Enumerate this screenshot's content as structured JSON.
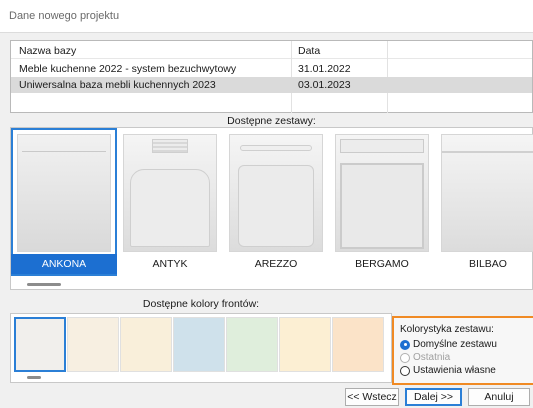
{
  "window": {
    "title": "Dane nowego projektu"
  },
  "db_table": {
    "columns": [
      "Nazwa bazy",
      "Data"
    ],
    "rows": [
      {
        "name": "Meble kuchenne 2022 - system bezuchwytowy",
        "date": "31.01.2022",
        "selected": false
      },
      {
        "name": "Uniwersalna baza mebli kuchennych 2023",
        "date": "03.01.2023",
        "selected": true
      }
    ]
  },
  "sets": {
    "label": "Dostępne zestawy:",
    "items": [
      {
        "name": "ANKONA",
        "selected": true
      },
      {
        "name": "ANTYK",
        "selected": false
      },
      {
        "name": "AREZZO",
        "selected": false
      },
      {
        "name": "BERGAMO",
        "selected": false
      },
      {
        "name": "BILBAO",
        "selected": false
      }
    ]
  },
  "front_colors": {
    "label": "Dostępne kolory frontów:",
    "swatches": [
      "#f1efec",
      "#f7efe1",
      "#f9efda",
      "#cfe1eb",
      "#dfeedc",
      "#fcefd3",
      "#fbe3c8"
    ]
  },
  "color_scheme": {
    "legend": "Kolorystyka zestawu:",
    "options": [
      {
        "label": "Domyślne zestawu",
        "checked": true,
        "disabled": false
      },
      {
        "label": "Ostatnia",
        "checked": false,
        "disabled": true
      },
      {
        "label": "Ustawienia własne",
        "checked": false,
        "disabled": false
      }
    ]
  },
  "buttons": {
    "back": "<< Wstecz",
    "next": "Dalej >>",
    "cancel": "Anuluj"
  },
  "colors": {
    "accent": "#1c6fd1",
    "highlight": "#f08a24"
  }
}
